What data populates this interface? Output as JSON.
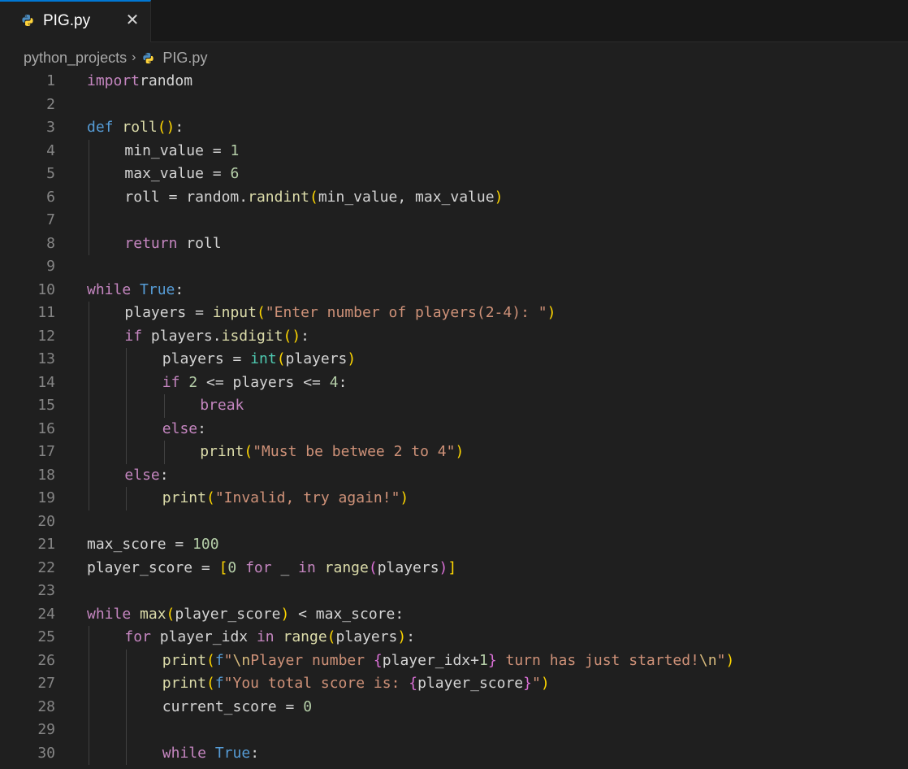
{
  "tab": {
    "filename": "PIG.py",
    "close_glyph": "✕"
  },
  "breadcrumb": {
    "folder": "python_projects",
    "separator": "›",
    "file": "PIG.py"
  },
  "colors": {
    "accent": "#0078d4",
    "python_blue": "#4b8bbe",
    "python_yellow": "#ffd43b"
  },
  "lines": [
    {
      "n": "1",
      "indent": 0,
      "tokens": [
        [
          "kw",
          "import"
        ],
        [
          "",
          "random"
        ]
      ]
    },
    {
      "n": "2",
      "indent": 0,
      "tokens": []
    },
    {
      "n": "3",
      "indent": 0,
      "tokens": [
        [
          "kd",
          "def "
        ],
        [
          "fn",
          "roll"
        ],
        [
          "b1",
          "()"
        ],
        [
          "",
          ":"
        ]
      ]
    },
    {
      "n": "4",
      "indent": 1,
      "tokens": [
        [
          "",
          "min_value = "
        ],
        [
          "nm",
          "1"
        ]
      ]
    },
    {
      "n": "5",
      "indent": 1,
      "tokens": [
        [
          "",
          "max_value = "
        ],
        [
          "nm",
          "6"
        ]
      ]
    },
    {
      "n": "6",
      "indent": 1,
      "tokens": [
        [
          "",
          "roll = random."
        ],
        [
          "fn",
          "randint"
        ],
        [
          "b1",
          "("
        ],
        [
          "",
          "min_value, max_value"
        ],
        [
          "b1",
          ")"
        ]
      ]
    },
    {
      "n": "7",
      "indent": 0,
      "tokens": []
    },
    {
      "n": "8",
      "indent": 1,
      "tokens": [
        [
          "kw",
          "return"
        ],
        [
          "",
          " roll"
        ]
      ]
    },
    {
      "n": "9",
      "indent": 0,
      "tokens": []
    },
    {
      "n": "10",
      "indent": 0,
      "tokens": [
        [
          "kw",
          "while"
        ],
        [
          "",
          " "
        ],
        [
          "kd",
          "True"
        ],
        [
          "",
          ":"
        ]
      ]
    },
    {
      "n": "11",
      "indent": 1,
      "tokens": [
        [
          "",
          "players = "
        ],
        [
          "fn",
          "input"
        ],
        [
          "b1",
          "("
        ],
        [
          "st",
          "\"Enter number of players(2-4): \""
        ],
        [
          "b1",
          ")"
        ]
      ]
    },
    {
      "n": "12",
      "indent": 1,
      "tokens": [
        [
          "kw",
          "if"
        ],
        [
          "",
          " players."
        ],
        [
          "fn",
          "isdigit"
        ],
        [
          "b1",
          "()"
        ],
        [
          "",
          ":"
        ]
      ]
    },
    {
      "n": "13",
      "indent": 2,
      "tokens": [
        [
          "",
          "players = "
        ],
        [
          "bi",
          "int"
        ],
        [
          "b1",
          "("
        ],
        [
          "",
          "players"
        ],
        [
          "b1",
          ")"
        ]
      ]
    },
    {
      "n": "14",
      "indent": 2,
      "tokens": [
        [
          "kw",
          "if"
        ],
        [
          "",
          " "
        ],
        [
          "nm",
          "2"
        ],
        [
          "",
          " <= players <= "
        ],
        [
          "nm",
          "4"
        ],
        [
          "",
          ":"
        ]
      ]
    },
    {
      "n": "15",
      "indent": 3,
      "tokens": [
        [
          "kw",
          "break"
        ]
      ]
    },
    {
      "n": "16",
      "indent": 2,
      "tokens": [
        [
          "kw",
          "else"
        ],
        [
          "",
          ":"
        ]
      ]
    },
    {
      "n": "17",
      "indent": 3,
      "tokens": [
        [
          "fn",
          "print"
        ],
        [
          "b1",
          "("
        ],
        [
          "st",
          "\"Must be betwee 2 to 4\""
        ],
        [
          "b1",
          ")"
        ]
      ]
    },
    {
      "n": "18",
      "indent": 1,
      "tokens": [
        [
          "kw",
          "else"
        ],
        [
          "",
          ":"
        ]
      ]
    },
    {
      "n": "19",
      "indent": 2,
      "tokens": [
        [
          "fn",
          "print"
        ],
        [
          "b1",
          "("
        ],
        [
          "st",
          "\"Invalid, try again!\""
        ],
        [
          "b1",
          ")"
        ]
      ]
    },
    {
      "n": "20",
      "indent": 0,
      "tokens": []
    },
    {
      "n": "21",
      "indent": 0,
      "tokens": [
        [
          "",
          "max_score = "
        ],
        [
          "nm",
          "100"
        ]
      ]
    },
    {
      "n": "22",
      "indent": 0,
      "tokens": [
        [
          "",
          "player_score = "
        ],
        [
          "b1",
          "["
        ],
        [
          "nm",
          "0"
        ],
        [
          "",
          " "
        ],
        [
          "kw",
          "for"
        ],
        [
          "",
          " _ "
        ],
        [
          "kw",
          "in"
        ],
        [
          "",
          " "
        ],
        [
          "fn",
          "range"
        ],
        [
          "b2",
          "("
        ],
        [
          "",
          "players"
        ],
        [
          "b2",
          ")"
        ],
        [
          "b1",
          "]"
        ]
      ]
    },
    {
      "n": "23",
      "indent": 0,
      "tokens": []
    },
    {
      "n": "24",
      "indent": 0,
      "tokens": [
        [
          "kw",
          "while"
        ],
        [
          "",
          " "
        ],
        [
          "fn",
          "max"
        ],
        [
          "b1",
          "("
        ],
        [
          "",
          "player_score"
        ],
        [
          "b1",
          ")"
        ],
        [
          "",
          " < max_score:"
        ]
      ]
    },
    {
      "n": "25",
      "indent": 1,
      "tokens": [
        [
          "kw",
          "for"
        ],
        [
          "",
          " player_idx "
        ],
        [
          "kw",
          "in"
        ],
        [
          "",
          " "
        ],
        [
          "fn",
          "range"
        ],
        [
          "b1",
          "("
        ],
        [
          "",
          "players"
        ],
        [
          "b1",
          ")"
        ],
        [
          "",
          ":"
        ]
      ]
    },
    {
      "n": "26",
      "indent": 2,
      "tokens": [
        [
          "fn",
          "print"
        ],
        [
          "b1",
          "("
        ],
        [
          "kd",
          "f"
        ],
        [
          "st",
          "\""
        ],
        [
          "es",
          "\\n"
        ],
        [
          "st",
          "Player number "
        ],
        [
          "b2",
          "{"
        ],
        [
          "",
          "player_idx+"
        ],
        [
          "nm",
          "1"
        ],
        [
          "b2",
          "}"
        ],
        [
          "st",
          " turn has just started!"
        ],
        [
          "es",
          "\\n"
        ],
        [
          "st",
          "\""
        ],
        [
          "b1",
          ")"
        ]
      ]
    },
    {
      "n": "27",
      "indent": 2,
      "tokens": [
        [
          "fn",
          "print"
        ],
        [
          "b1",
          "("
        ],
        [
          "kd",
          "f"
        ],
        [
          "st",
          "\"You total score is: "
        ],
        [
          "b2",
          "{"
        ],
        [
          "",
          "player_score"
        ],
        [
          "b2",
          "}"
        ],
        [
          "st",
          "\""
        ],
        [
          "b1",
          ")"
        ]
      ]
    },
    {
      "n": "28",
      "indent": 2,
      "tokens": [
        [
          "",
          "current_score = "
        ],
        [
          "nm",
          "0"
        ]
      ]
    },
    {
      "n": "29",
      "indent": 0,
      "tokens": []
    },
    {
      "n": "30",
      "indent": 2,
      "tokens": [
        [
          "kw",
          "while"
        ],
        [
          "",
          " "
        ],
        [
          "kd",
          "True"
        ],
        [
          "",
          ":"
        ]
      ]
    }
  ]
}
